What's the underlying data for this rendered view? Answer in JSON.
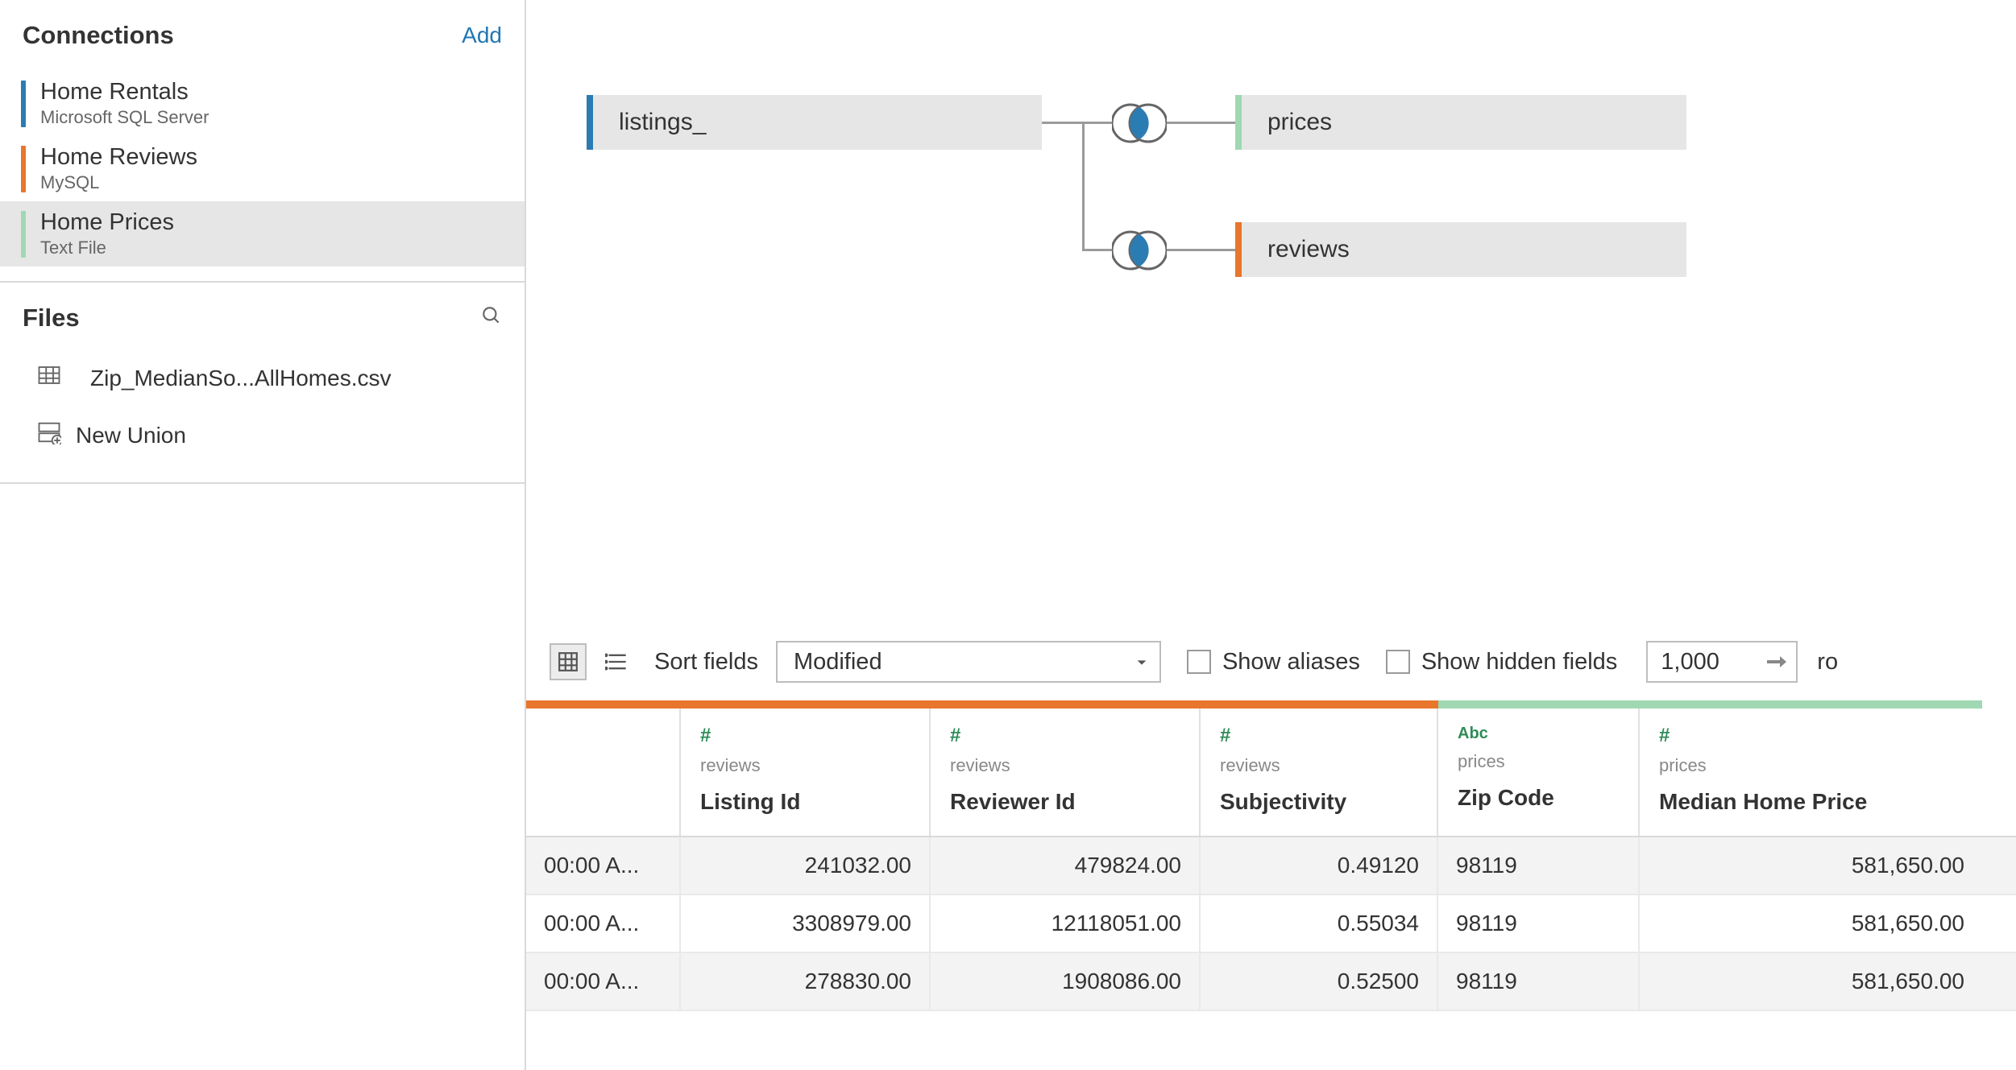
{
  "sidebar": {
    "connections_title": "Connections",
    "add_label": "Add",
    "connections": [
      {
        "name": "Home Rentals",
        "sub": "Microsoft SQL Server",
        "color": "blue",
        "selected": false
      },
      {
        "name": "Home Reviews",
        "sub": "MySQL",
        "color": "orange",
        "selected": false
      },
      {
        "name": "Home Prices",
        "sub": "Text File",
        "color": "green",
        "selected": true
      }
    ],
    "files_title": "Files",
    "files": [
      {
        "name": "Zip_MedianSo...AllHomes.csv"
      }
    ],
    "new_union": "New Union"
  },
  "canvas": {
    "nodes": {
      "listings": {
        "label": "listings_",
        "color": "blue"
      },
      "prices": {
        "label": "prices",
        "color": "green"
      },
      "reviews": {
        "label": "reviews",
        "color": "orange"
      }
    }
  },
  "toolbar": {
    "sort_label": "Sort fields",
    "sort_value": "Modified",
    "show_aliases": "Show aliases",
    "show_hidden": "Show hidden fields",
    "row_limit": "1,000",
    "rows_label": "ro"
  },
  "grid": {
    "columns": [
      {
        "type": "",
        "type_class": "",
        "source": "",
        "name": ""
      },
      {
        "type": "#",
        "type_class": "green",
        "source": "reviews",
        "name": "Listing Id"
      },
      {
        "type": "#",
        "type_class": "green",
        "source": "reviews",
        "name": "Reviewer Id"
      },
      {
        "type": "#",
        "type_class": "green",
        "source": "reviews",
        "name": "Subjectivity"
      },
      {
        "type": "Abc",
        "type_class": "abc",
        "source": "prices",
        "name": "Zip Code"
      },
      {
        "type": "#",
        "type_class": "green",
        "source": "prices",
        "name": "Median Home Price"
      }
    ],
    "rows": [
      {
        "c0": "00:00 A...",
        "c1": "241032.00",
        "c2": "479824.00",
        "c3": "0.49120",
        "c4": "98119",
        "c5": "581,650.00"
      },
      {
        "c0": "00:00 A...",
        "c1": "3308979.00",
        "c2": "12118051.00",
        "c3": "0.55034",
        "c4": "98119",
        "c5": "581,650.00"
      },
      {
        "c0": "00:00 A...",
        "c1": "278830.00",
        "c2": "1908086.00",
        "c3": "0.52500",
        "c4": "98119",
        "c5": "581,650.00"
      }
    ]
  }
}
